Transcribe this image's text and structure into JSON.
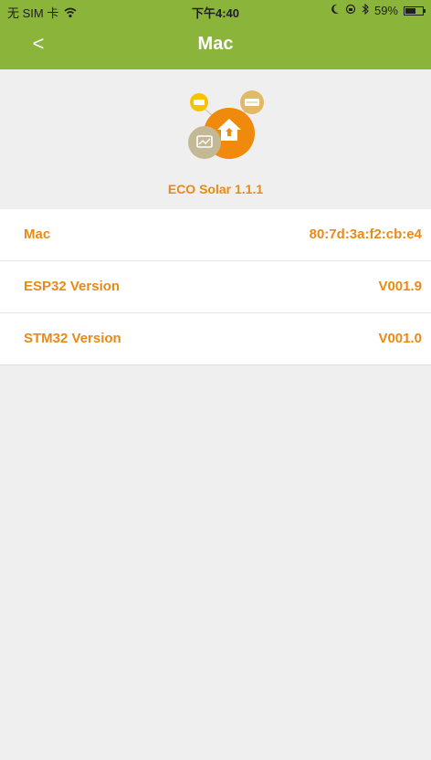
{
  "status_bar": {
    "carrier": "无 SIM 卡",
    "time": "下午4:40",
    "battery_percent": "59%",
    "battery_level": 0.59,
    "icons": [
      "wifi-icon",
      "moon-icon",
      "lock-rotation-icon",
      "bluetooth-icon",
      "battery-icon"
    ]
  },
  "nav": {
    "back_label": "<",
    "title": "Mac",
    "color": "#8bb43a"
  },
  "hero": {
    "app_name": "ECO Solar 1.1.1",
    "logo_icon": "eco-solar-logo-icon",
    "accent": "#f08a0c"
  },
  "info": {
    "rows": [
      {
        "label": "Mac",
        "value": "80:7d:3a:f2:cb:e4"
      },
      {
        "label": "ESP32 Version",
        "value": "V001.9"
      },
      {
        "label": "STM32 Version",
        "value": "V001.0"
      }
    ],
    "text_color": "#e98a17"
  }
}
